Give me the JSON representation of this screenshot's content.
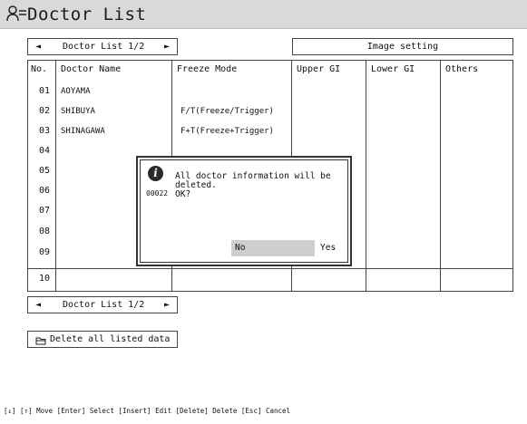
{
  "window": {
    "title": "Doctor List",
    "title_icon": "doctor-list-icon"
  },
  "pager_top": {
    "label": "Doctor List 1/2",
    "prev_glyph": "◄",
    "next_glyph": "►"
  },
  "pager_bottom": {
    "label": "Doctor List 1/2",
    "prev_glyph": "◄",
    "next_glyph": "►"
  },
  "image_setting": {
    "label": "Image setting"
  },
  "table": {
    "headers": {
      "no": "No.",
      "name": "Doctor Name",
      "freeze": "Freeze Mode",
      "upper": "Upper GI",
      "lower": "Lower GI",
      "others": "Others"
    },
    "rows": [
      {
        "no": "01",
        "name": "AOYAMA",
        "freeze": ""
      },
      {
        "no": "02",
        "name": "SHIBUYA",
        "freeze": "F/T(Freeze/Trigger)"
      },
      {
        "no": "03",
        "name": "SHINAGAWA",
        "freeze": "F+T(Freeze+Trigger)"
      },
      {
        "no": "04",
        "name": "",
        "freeze": ""
      },
      {
        "no": "05",
        "name": "",
        "freeze": ""
      },
      {
        "no": "06",
        "name": "",
        "freeze": ""
      },
      {
        "no": "07",
        "name": "",
        "freeze": ""
      },
      {
        "no": "08",
        "name": "",
        "freeze": ""
      },
      {
        "no": "09",
        "name": "",
        "freeze": ""
      },
      {
        "no": "10",
        "name": "",
        "freeze": ""
      }
    ]
  },
  "dialog": {
    "icon": "info-icon",
    "code": "00022",
    "message": "All doctor information will be deleted.\nOK?",
    "no_label": "No",
    "yes_label": "Yes"
  },
  "delete_all": {
    "icon": "folder-icon",
    "label": "Delete all listed data"
  },
  "status_bar": "[↓] [↑] Move  [Enter] Select  [Insert] Edit  [Delete] Delete  [Esc] Cancel"
}
